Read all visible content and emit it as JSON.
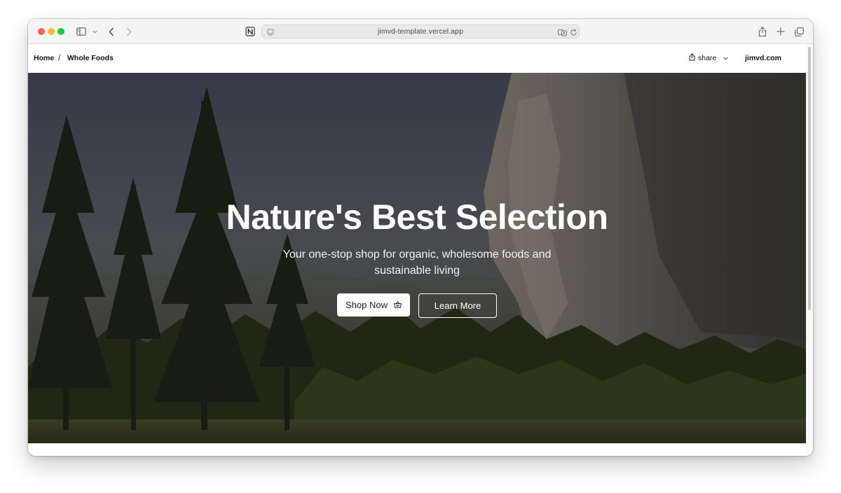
{
  "browser": {
    "url": "jimvd-template.vercel.app",
    "icons": [
      "sidebar-icon",
      "chevron-down-icon",
      "back-icon",
      "forward-icon",
      "notion-icon",
      "page-menu-icon",
      "translate-icon",
      "reload-icon",
      "share-icon",
      "new-tab-icon",
      "tabs-overview-icon"
    ]
  },
  "header": {
    "breadcrumb": [
      {
        "label": "Home"
      },
      {
        "label": "Whole Foods"
      }
    ],
    "breadcrumb_separator": "/",
    "share_label": "share",
    "site_link": "jimvd.com"
  },
  "hero": {
    "title": "Nature's Best Selection",
    "subtitle": "Your one-stop shop for organic, wholesome foods and sustainable living",
    "primary_button": "Shop Now",
    "secondary_button": "Learn More"
  },
  "colors": {
    "traffic_close": "#fe5f57",
    "traffic_minimize": "#febc2e",
    "traffic_maximize": "#28c840",
    "hero_text": "#ffffff"
  }
}
